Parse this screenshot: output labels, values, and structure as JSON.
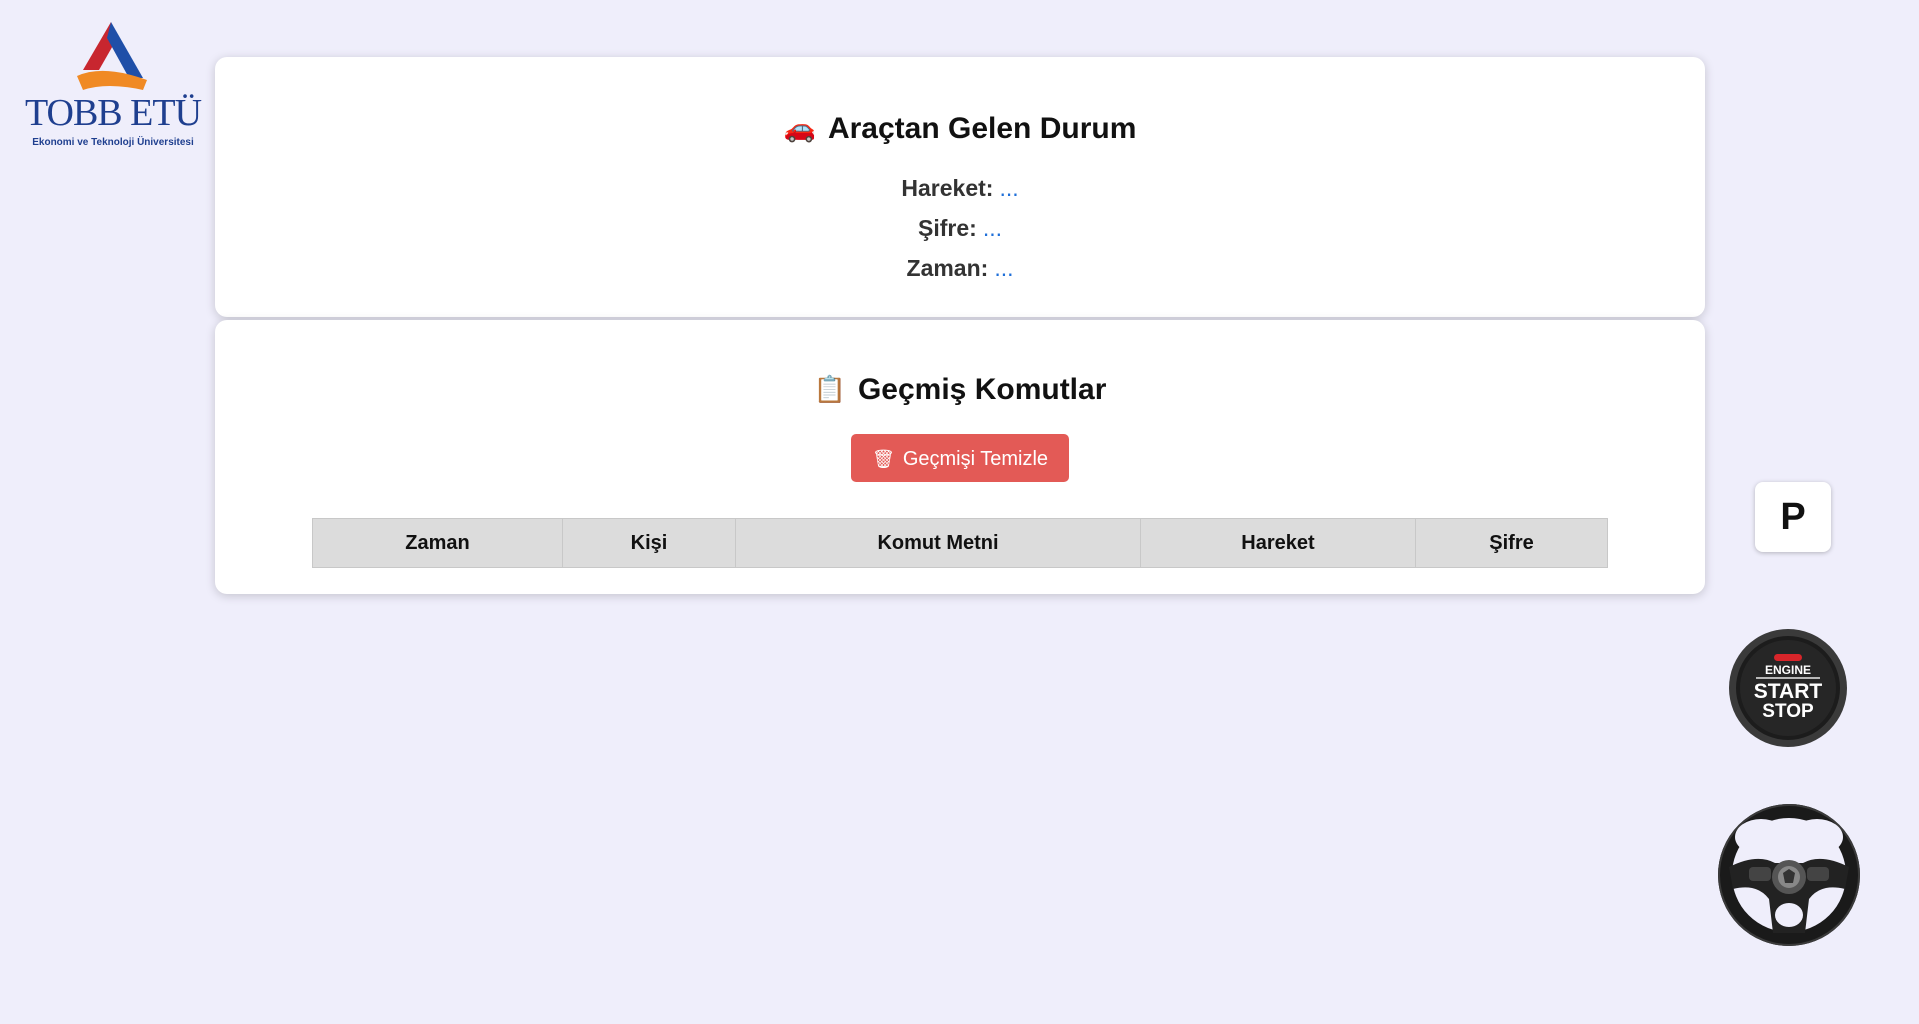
{
  "logo": {
    "title": "TOBB ETÜ",
    "subtitle": "Ekonomi ve Teknoloji Üniversitesi"
  },
  "status_card": {
    "icon": "car-icon",
    "title": "Araçtan Gelen Durum",
    "lines": [
      {
        "label": "Hareket:",
        "value": "..."
      },
      {
        "label": "Şifre:",
        "value": "..."
      },
      {
        "label": "Zaman:",
        "value": "..."
      }
    ]
  },
  "history_card": {
    "icon": "clipboard-icon",
    "title": "Geçmiş Komutlar",
    "clear_button": "Geçmişi Temizle",
    "columns": [
      "Zaman",
      "Kişi",
      "Komut Metni",
      "Hareket",
      "Şifre"
    ]
  },
  "controls": {
    "park_label": "P",
    "engine_top": "ENGINE",
    "engine_start": "START",
    "engine_stop": "STOP"
  },
  "colors": {
    "background": "#efeefb",
    "accent_value": "#1e6fd9",
    "danger_button": "#e35a56",
    "brand_blue": "#1f3f8f",
    "brand_red": "#c8262f",
    "brand_orange": "#f08a24"
  }
}
